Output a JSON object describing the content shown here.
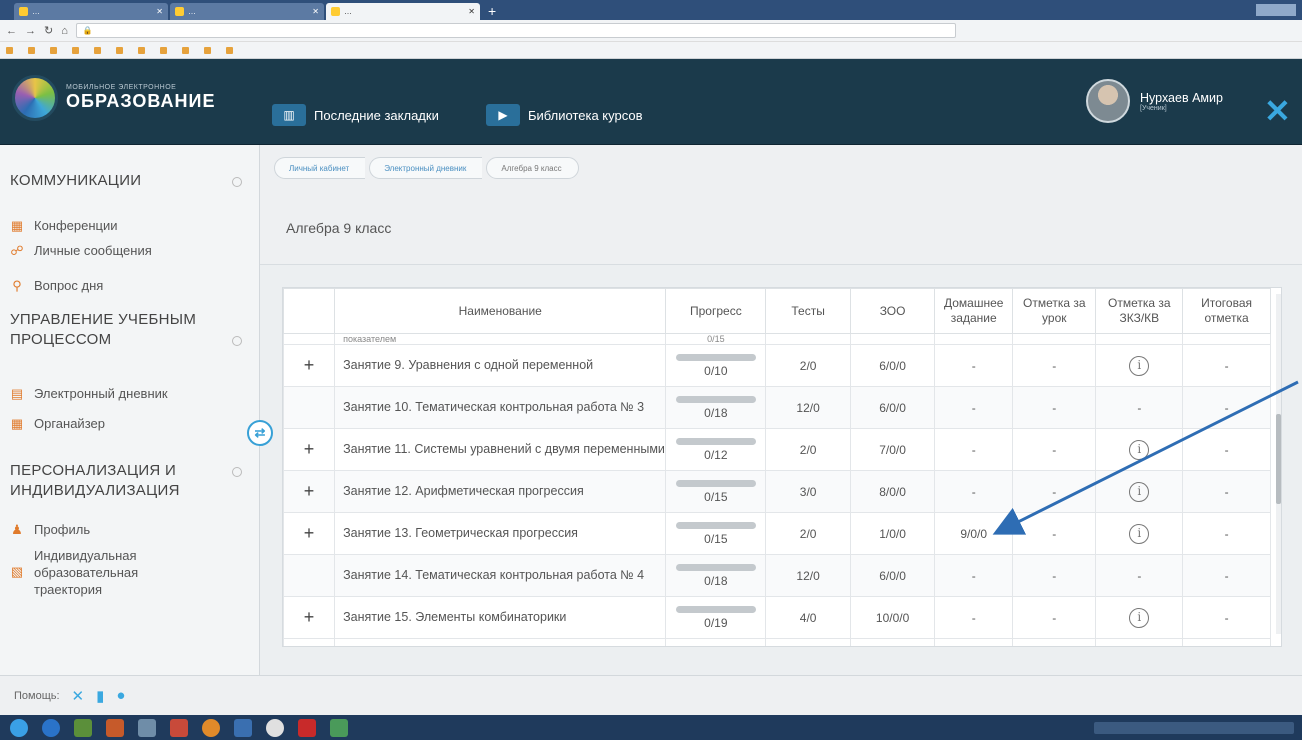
{
  "browser": {
    "tabs": [
      {
        "label": "…",
        "active": false
      },
      {
        "label": "…",
        "active": false
      },
      {
        "label": "…",
        "active": true
      }
    ],
    "new_tab": "+",
    "zoom": "",
    "bookmarks": [
      "",
      "",
      "",
      "",
      "",
      "",
      "",
      "",
      "",
      "",
      ""
    ]
  },
  "header": {
    "logo_small": "МОБИЛЬНОЕ ЭЛЕКТРОННОЕ",
    "logo_big": "ОБРАЗОВАНИЕ",
    "nav": [
      {
        "label": "Последние закладки",
        "icon": "book-icon"
      },
      {
        "label": "Библиотека курсов",
        "icon": "video-icon"
      }
    ],
    "user_name": "Нурхаев Амир",
    "user_role": "[Ученик]",
    "close": "✕"
  },
  "sidebar": {
    "sections": [
      {
        "title": "КОММУНИКАЦИИ",
        "items": [
          "Конференции",
          "Личные сообщения",
          "Вопрос дня"
        ]
      },
      {
        "title": "УПРАВЛЕНИЕ УЧЕБНЫМ ПРОЦЕССОМ",
        "items": [
          "Электронный дневник",
          "Органайзер"
        ]
      },
      {
        "title": "ПЕРСОНАЛИЗАЦИЯ И ИНДИВИДУАЛИЗАЦИЯ",
        "items": [
          "Профиль",
          "Индивидуальная образовательная траектория"
        ]
      }
    ]
  },
  "breadcrumb": [
    "Личный кабинет",
    "Электронный дневник",
    "Алгебра 9 класс"
  ],
  "page_title": "Алгебра 9 класс",
  "table": {
    "headers": [
      "Наименование",
      "Прогресс",
      "Тесты",
      "ЗОО",
      "Домашнее задание",
      "Отметка за урок",
      "Отметка за ЗКЗ/КВ",
      "Итоговая отметка"
    ],
    "cut_row_text": "показателем",
    "cut_row_progress": "0/15",
    "rows": [
      {
        "plus": "+",
        "name": "Занятие 9. Уравнения с одной переменной",
        "progress": "0/10",
        "tests": "2/0",
        "zoo": "6/0/0",
        "hw": "-",
        "lesson": "-",
        "zkz": "info",
        "final": "-"
      },
      {
        "plus": "",
        "name": "Занятие 10. Тематическая контрольная работа № 3",
        "progress": "0/18",
        "tests": "12/0",
        "zoo": "6/0/0",
        "hw": "-",
        "lesson": "-",
        "zkz": "-",
        "final": "-"
      },
      {
        "plus": "+",
        "name": "Занятие 11. Системы уравнений с двумя переменными",
        "progress": "0/12",
        "tests": "2/0",
        "zoo": "7/0/0",
        "hw": "-",
        "lesson": "-",
        "zkz": "info",
        "final": "-"
      },
      {
        "plus": "+",
        "name": "Занятие 12. Арифметическая прогрессия",
        "progress": "0/15",
        "tests": "3/0",
        "zoo": "8/0/0",
        "hw": "-",
        "lesson": "-",
        "zkz": "info",
        "final": "-"
      },
      {
        "plus": "+",
        "name": "Занятие 13. Геометрическая прогрессия",
        "progress": "0/15",
        "tests": "2/0",
        "zoo": "1/0/0",
        "hw": "9/0/0",
        "lesson": "-",
        "zkz": "info",
        "final": "-"
      },
      {
        "plus": "",
        "name": "Занятие 14. Тематическая контрольная работа № 4",
        "progress": "0/18",
        "tests": "12/0",
        "zoo": "6/0/0",
        "hw": "-",
        "lesson": "-",
        "zkz": "-",
        "final": "-"
      },
      {
        "plus": "+",
        "name": "Занятие 15. Элементы комбинаторики",
        "progress": "0/19",
        "tests": "4/0",
        "zoo": "10/0/0",
        "hw": "-",
        "lesson": "-",
        "zkz": "info",
        "final": "-"
      }
    ]
  },
  "help": {
    "label": "Помощь:"
  },
  "colors": {
    "header_bg": "#1b3a4b",
    "accent": "#3aa8e0",
    "arrow": "#2e6db4"
  }
}
